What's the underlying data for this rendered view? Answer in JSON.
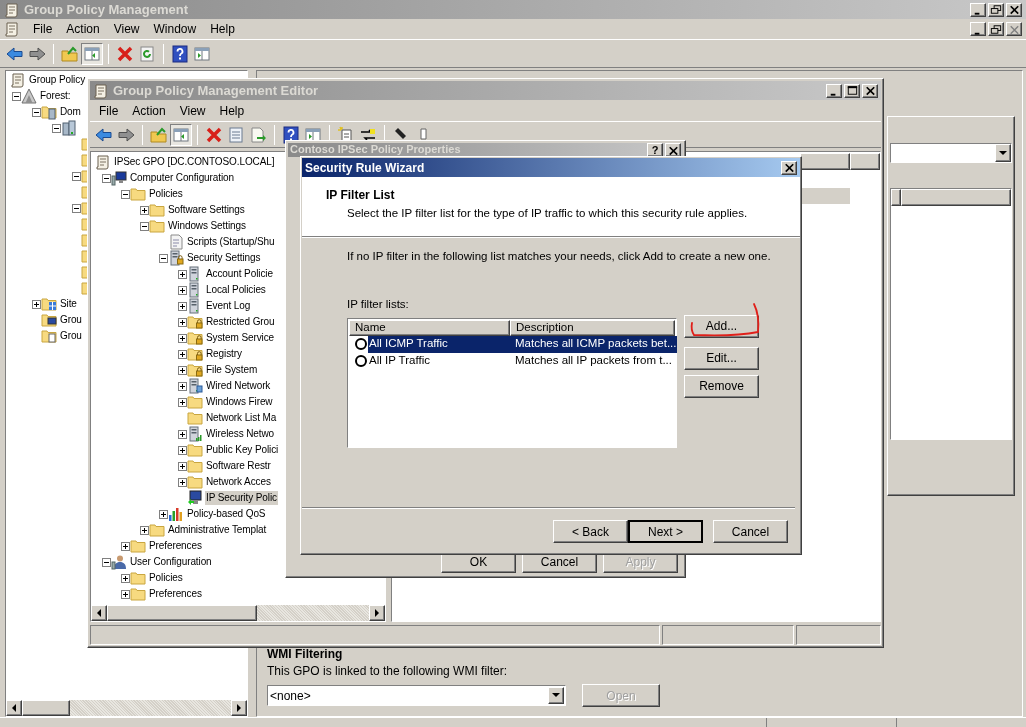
{
  "main_window": {
    "title": "Group Policy Management",
    "menu": [
      "File",
      "Action",
      "View",
      "Window",
      "Help"
    ],
    "tree": [
      {
        "label": "Group Policy",
        "kind": "console",
        "children": [
          {
            "label": "Forest:",
            "kind": "forest",
            "expanded": true,
            "children": [
              {
                "label": "Dom",
                "kind": "domains",
                "expanded": true,
                "children": [
                  {
                    "kind": "domain",
                    "expanded": true,
                    "children": [
                      {
                        "kind": "folder"
                      },
                      {
                        "kind": "folder"
                      },
                      {
                        "kind": "folder",
                        "expanded": true
                      },
                      {
                        "kind": "folder"
                      },
                      {
                        "kind": "folder",
                        "expanded": true
                      },
                      {
                        "kind": "folder"
                      },
                      {
                        "kind": "folder"
                      },
                      {
                        "kind": "folder"
                      },
                      {
                        "kind": "folder"
                      },
                      {
                        "kind": "folder"
                      }
                    ]
                  }
                ]
              },
              {
                "label": "Site",
                "kind": "sites",
                "expanded": false
              },
              {
                "label": "Grou",
                "kind": "modeling"
              },
              {
                "label": "Grou",
                "kind": "results"
              }
            ]
          }
        ]
      }
    ],
    "wmi_filtering": {
      "heading": "WMI Filtering",
      "label": "This GPO is linked to the following WMI filter:",
      "value": "<none>",
      "open_button": {
        "label": "Open",
        "disabled": true
      }
    }
  },
  "editor_window": {
    "title": "Group Policy Management Editor",
    "menu": [
      "File",
      "Action",
      "View",
      "Help"
    ],
    "tree": [
      {
        "label": "IPSec GPO [DC.CONTOSO.LOCAL]",
        "kind": "gpo",
        "selected": false,
        "children": [
          {
            "label": "Computer Configuration",
            "kind": "computer",
            "expanded": true,
            "selected": false,
            "children": [
              {
                "label": "Policies",
                "kind": "folder",
                "expanded": true,
                "selected": false,
                "children": [
                  {
                    "label": "Software Settings",
                    "kind": "folder",
                    "expanded": false,
                    "selected": false
                  },
                  {
                    "label": "Windows Settings",
                    "kind": "folder",
                    "expanded": true,
                    "selected": false,
                    "children": [
                      {
                        "label": "Scripts (Startup/Shu",
                        "kind": "script",
                        "selected": false
                      },
                      {
                        "label": "Security Settings",
                        "kind": "security",
                        "expanded": true,
                        "selected": false,
                        "children": [
                          {
                            "label": "Account Policie",
                            "kind": "policy",
                            "expanded": false,
                            "selected": false
                          },
                          {
                            "label": "Local Policies",
                            "kind": "policy",
                            "expanded": false,
                            "selected": false
                          },
                          {
                            "label": "Event Log",
                            "kind": "policy",
                            "expanded": false,
                            "selected": false
                          },
                          {
                            "label": "Restricted Grou",
                            "kind": "locked-folder",
                            "expanded": false,
                            "selected": false
                          },
                          {
                            "label": "System Service",
                            "kind": "locked-folder",
                            "expanded": false,
                            "selected": false
                          },
                          {
                            "label": "Registry",
                            "kind": "locked-folder",
                            "expanded": false,
                            "selected": false
                          },
                          {
                            "label": "File System",
                            "kind": "locked-folder",
                            "expanded": false,
                            "selected": false
                          },
                          {
                            "label": "Wired Network",
                            "kind": "network",
                            "expanded": false,
                            "selected": false
                          },
                          {
                            "label": "Windows Firew",
                            "kind": "folder",
                            "expanded": false,
                            "selected": false
                          },
                          {
                            "label": "Network List Ma",
                            "kind": "folder",
                            "selected": false
                          },
                          {
                            "label": "Wireless Netwo",
                            "kind": "wireless",
                            "expanded": false,
                            "selected": false
                          },
                          {
                            "label": "Public Key Polici",
                            "kind": "folder",
                            "expanded": false,
                            "selected": false
                          },
                          {
                            "label": "Software Restr",
                            "kind": "folder",
                            "expanded": false,
                            "selected": false
                          },
                          {
                            "label": "Network Acces",
                            "kind": "folder",
                            "expanded": false,
                            "selected": false
                          },
                          {
                            "label": "IP Security Polic",
                            "kind": "ipsec",
                            "selected": true
                          }
                        ]
                      },
                      {
                        "label": "Policy-based QoS",
                        "kind": "qos",
                        "expanded": false,
                        "selected": false
                      }
                    ]
                  },
                  {
                    "label": "Administrative Templat",
                    "kind": "folder",
                    "expanded": false,
                    "selected": false
                  }
                ]
              },
              {
                "label": "Preferences",
                "kind": "folder",
                "expanded": false,
                "selected": false
              }
            ]
          },
          {
            "label": "User Configuration",
            "kind": "user",
            "expanded": true,
            "selected": false,
            "children": [
              {
                "label": "Policies",
                "kind": "folder",
                "expanded": false,
                "selected": false
              },
              {
                "label": "Preferences",
                "kind": "folder",
                "expanded": false,
                "selected": false
              }
            ]
          }
        ]
      }
    ]
  },
  "properties_dialog": {
    "title": "Contoso IPSec Policy Properties",
    "help_button": "?",
    "buttons": [
      {
        "label": "OK",
        "disabled": false
      },
      {
        "label": "Cancel",
        "disabled": false
      },
      {
        "label": "Apply",
        "disabled": true
      }
    ]
  },
  "wizard": {
    "title": "Security Rule Wizard",
    "heading": "IP Filter List",
    "subtitle": "Select the IP filter list for the type of IP traffic to which this security rule applies.",
    "instruction": "If no IP filter in the following list matches your needs, click Add to create a new one.",
    "list_label": "IP filter lists:",
    "columns": [
      "Name",
      "Description"
    ],
    "rows": [
      {
        "name": "All ICMP Traffic",
        "description": "Matches all ICMP packets bet...",
        "selected": true
      },
      {
        "name": "All IP Traffic",
        "description": "Matches all IP packets from t...",
        "selected": false
      }
    ],
    "side_buttons": [
      "Add...",
      "Edit...",
      "Remove"
    ],
    "nav_buttons": [
      {
        "label": "< Back",
        "default": false
      },
      {
        "label": "Next >",
        "default": true
      },
      {
        "label": "Cancel",
        "default": false
      }
    ]
  }
}
